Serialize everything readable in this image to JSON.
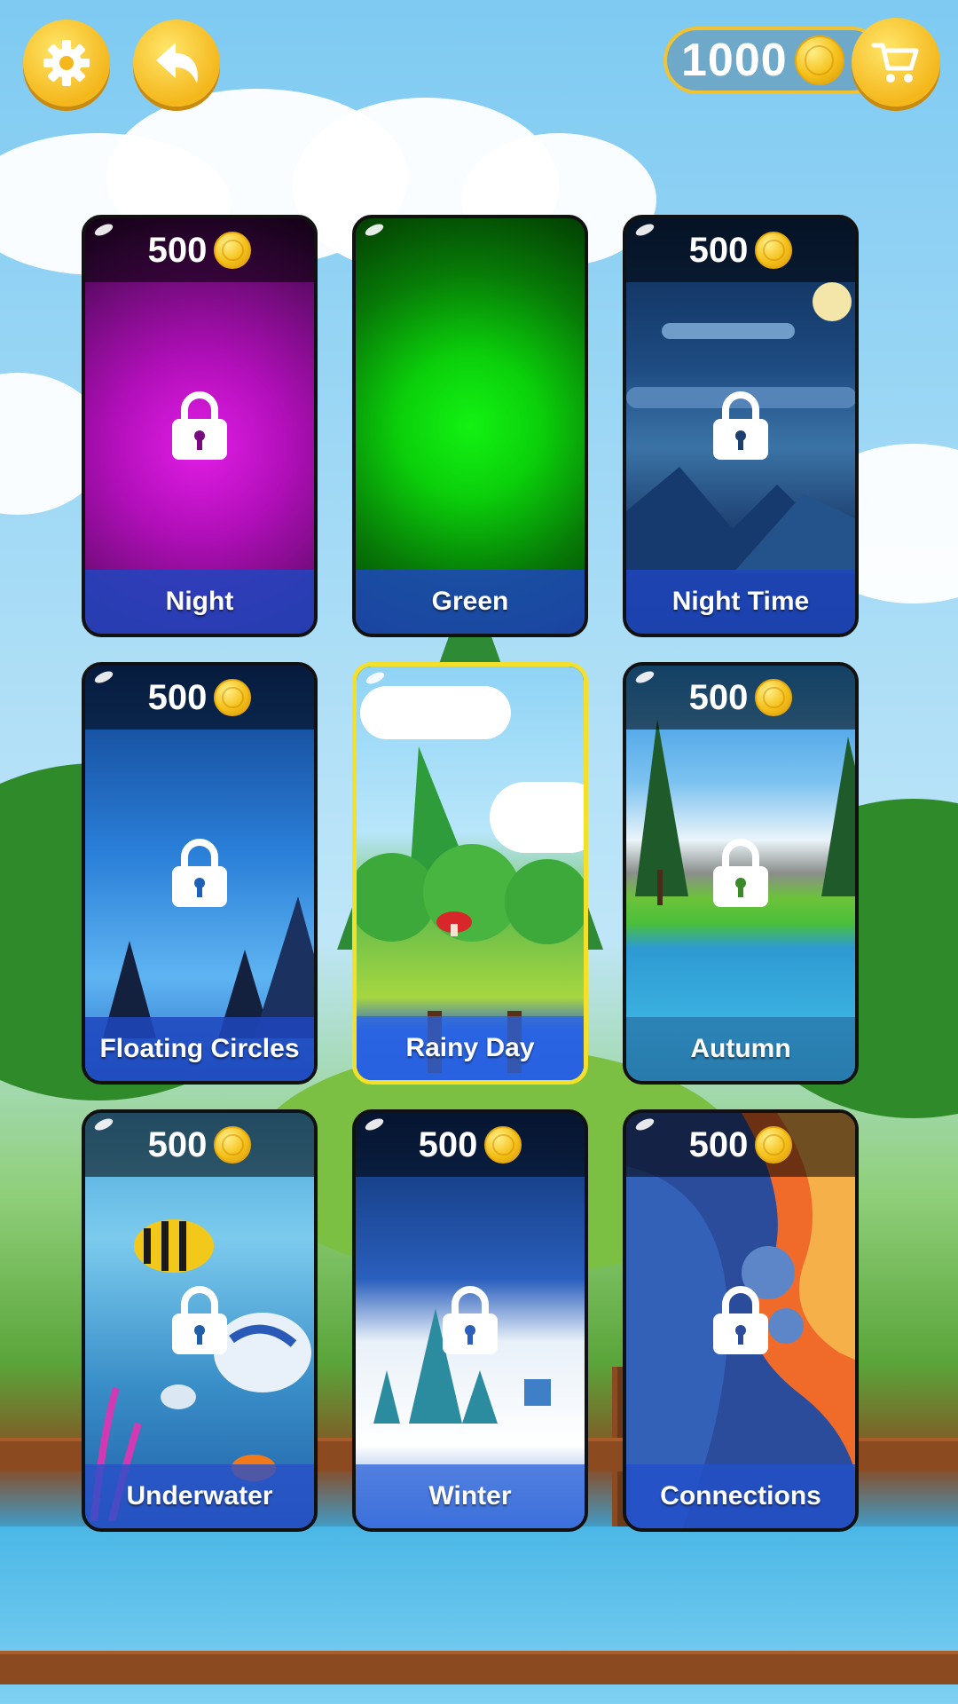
{
  "header": {
    "settings_icon": "gear-icon",
    "back_icon": "back-arrow-icon",
    "coins": "1000",
    "cart_icon": "cart-icon"
  },
  "cards": [
    {
      "name": "Night",
      "price": "500",
      "locked": true,
      "selected": false
    },
    {
      "name": "Green",
      "price": "",
      "locked": false,
      "selected": false
    },
    {
      "name": "Night Time",
      "price": "500",
      "locked": true,
      "selected": false
    },
    {
      "name": "Floating Circles",
      "price": "500",
      "locked": true,
      "selected": false
    },
    {
      "name": "Rainy Day",
      "price": "",
      "locked": false,
      "selected": true
    },
    {
      "name": "Autumn",
      "price": "500",
      "locked": true,
      "selected": false
    },
    {
      "name": "Underwater",
      "price": "500",
      "locked": true,
      "selected": false
    },
    {
      "name": "Winter",
      "price": "500",
      "locked": true,
      "selected": false
    },
    {
      "name": "Connections",
      "price": "500",
      "locked": true,
      "selected": false
    }
  ],
  "colors": {
    "accent": "#f4b71c",
    "selected_border": "#f2e02a",
    "label_bar": "#1e46be"
  }
}
